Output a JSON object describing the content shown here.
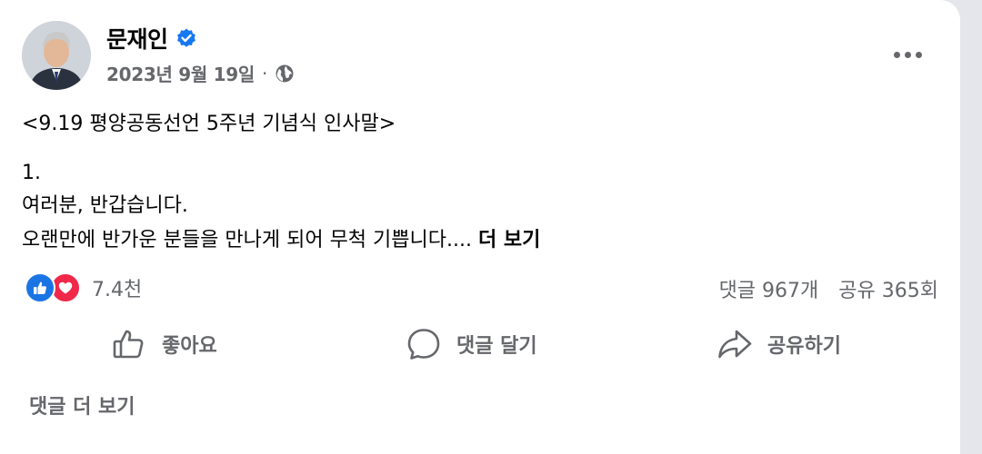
{
  "post": {
    "author": "문재인",
    "date": "2023년 9월 19일",
    "separator": "·",
    "icons": {
      "verified": "verified-badge-icon",
      "audience": "globe-icon",
      "more": "more-options-icon"
    },
    "text": {
      "title": "<9.19 평양공동선언 5주년 기념식 인사말>",
      "line1": "1.",
      "line2": "여러분, 반갑습니다.",
      "line3": "오랜만에 반가운 분들을 만나게 되어 무척 기쁩니다....",
      "see_more": "더 보기"
    }
  },
  "engagement": {
    "reactions_count": "7.4천",
    "reaction_types": [
      "like",
      "love"
    ],
    "comments": "댓글 967개",
    "shares": "공유 365회"
  },
  "actions": {
    "like": "좋아요",
    "comment": "댓글 달기",
    "share": "공유하기"
  },
  "footer": {
    "view_more_comments": "댓글 더 보기"
  },
  "colors": {
    "like_blue": "#1b74e4",
    "love_red": "#f0284a",
    "secondary_text": "#65676b",
    "verified_blue": "#1877f2"
  }
}
